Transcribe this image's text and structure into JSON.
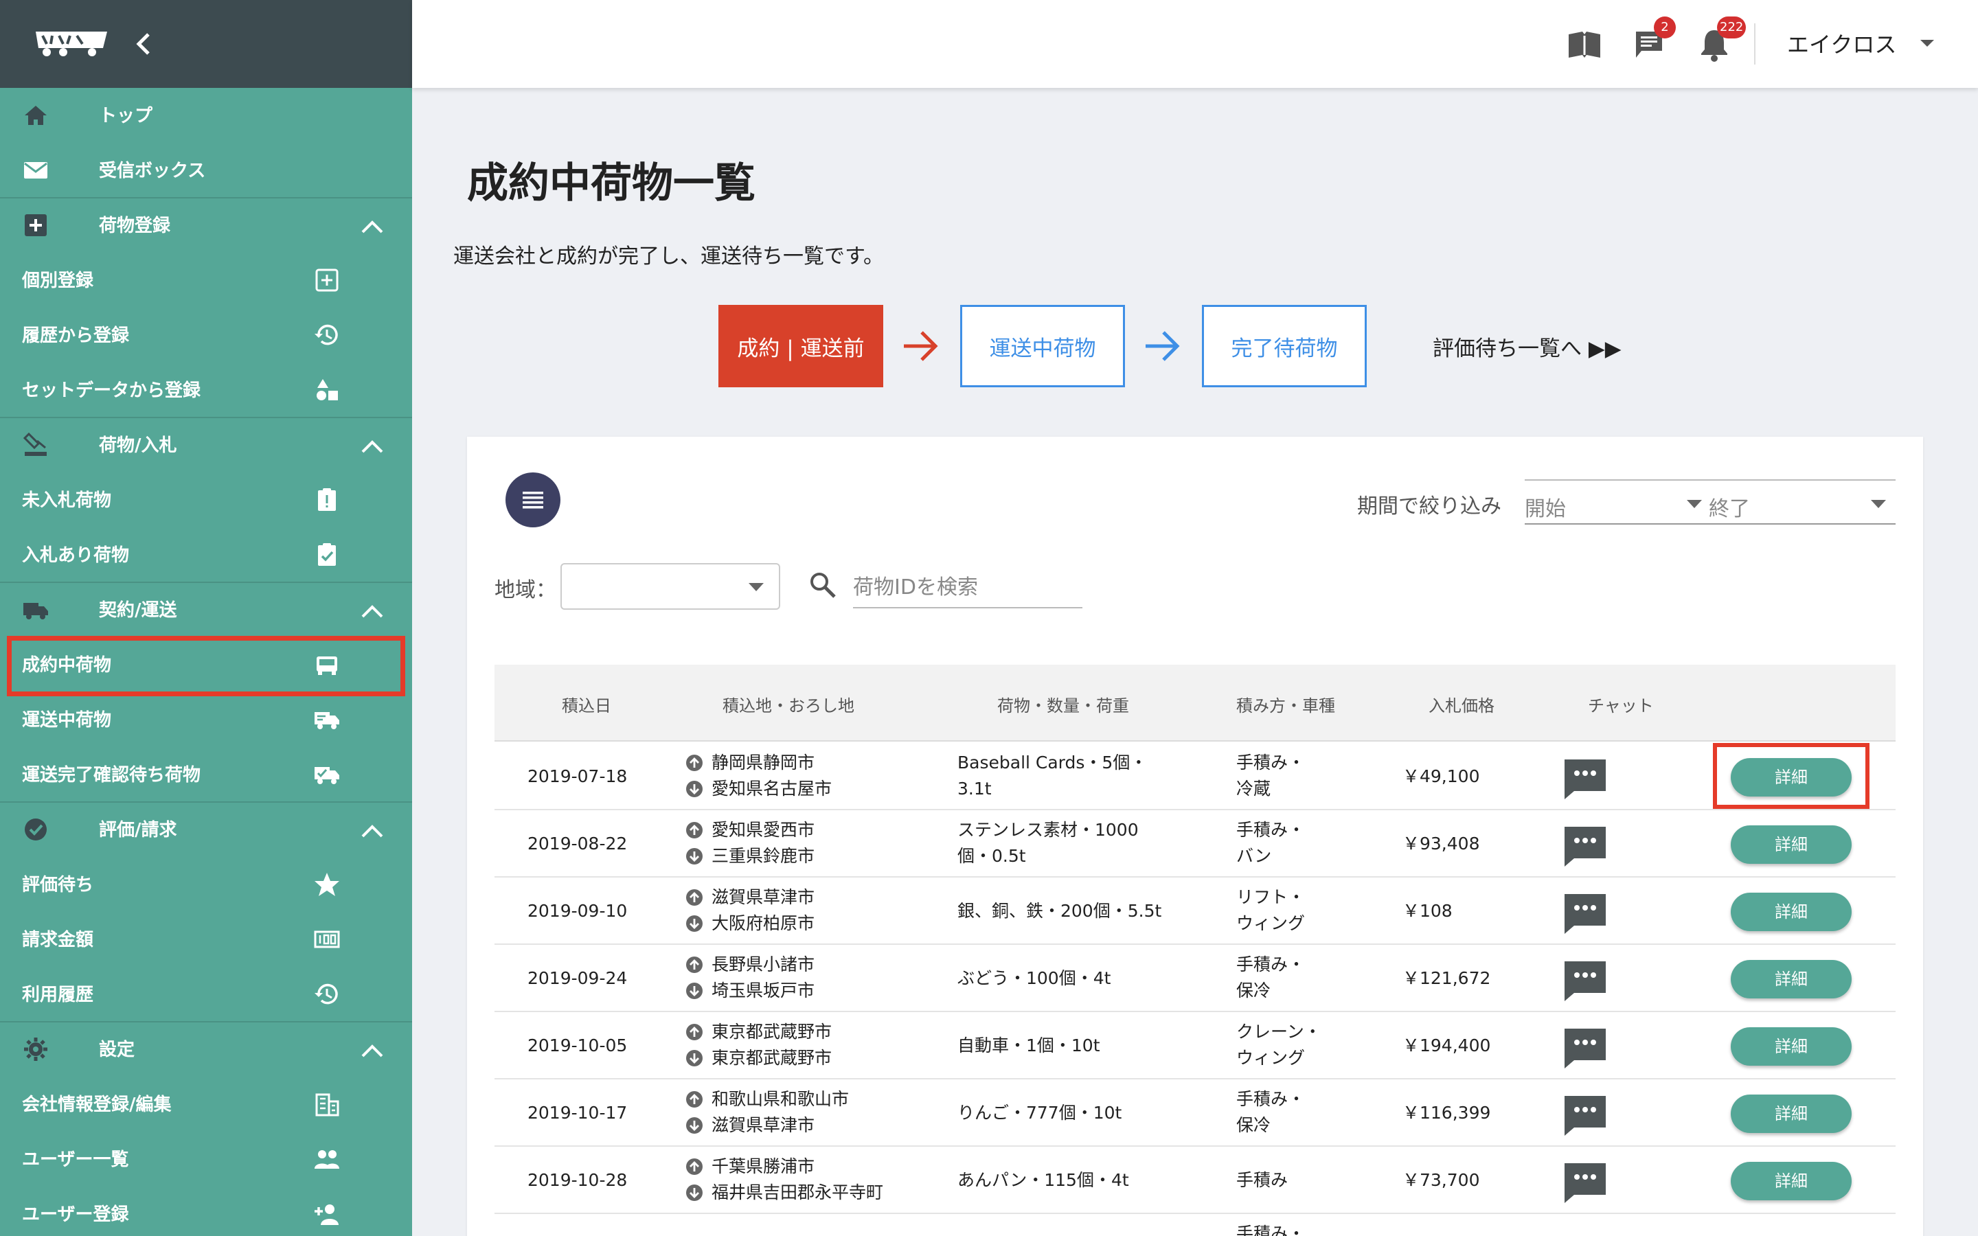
{
  "sidebar": {
    "items": [
      {
        "label": "トップ",
        "icon": "home-icon"
      },
      {
        "label": "受信ボックス",
        "icon": "mail-icon"
      },
      {
        "label": "荷物登録",
        "icon": "add-box-icon",
        "section": true
      },
      {
        "label": "個別登録",
        "icon": "add-square-icon"
      },
      {
        "label": "履歴から登録",
        "icon": "history-icon"
      },
      {
        "label": "セットデータから登録",
        "icon": "shapes-icon"
      },
      {
        "label": "荷物/入札",
        "icon": "bid-icon",
        "section": true
      },
      {
        "label": "未入札荷物",
        "icon": "clipboard-alert-icon"
      },
      {
        "label": "入札あり荷物",
        "icon": "clipboard-check-icon"
      },
      {
        "label": "契約/運送",
        "icon": "truck-icon",
        "section": true
      },
      {
        "label": "成約中荷物",
        "icon": "truck-front-icon",
        "active": true
      },
      {
        "label": "運送中荷物",
        "icon": "truck-moving-icon"
      },
      {
        "label": "運送完了確認待ち荷物",
        "icon": "truck-check-icon"
      },
      {
        "label": "評価/請求",
        "icon": "check-circle-icon",
        "section": true
      },
      {
        "label": "評価待ち",
        "icon": "star-icon"
      },
      {
        "label": "請求金額",
        "icon": "counter-icon"
      },
      {
        "label": "利用履歴",
        "icon": "history-icon"
      },
      {
        "label": "設定",
        "icon": "gear-icon",
        "section": true
      },
      {
        "label": "会社情報登録/編集",
        "icon": "building-icon"
      },
      {
        "label": "ユーザー一覧",
        "icon": "users-icon"
      },
      {
        "label": "ユーザー登録",
        "icon": "user-add-icon"
      }
    ]
  },
  "header": {
    "chat_badge": "2",
    "notification_badge": "222",
    "user_name": "エイクロス"
  },
  "main": {
    "title": "成約中荷物一覧",
    "description": "運送会社と成約が完了し、運送待ち一覧です。",
    "steps": [
      "成約 | 運送前",
      "運送中荷物",
      "完了待荷物"
    ],
    "review_link": "評価待ち一覧へ ▶▶",
    "period_label": "期間で絞り込み",
    "period_start_placeholder": "開始",
    "period_end_placeholder": "終了",
    "region_label": "地域：",
    "search_placeholder": "荷物IDを検索"
  },
  "table": {
    "columns": [
      "積込日",
      "積込地・おろし地",
      "荷物・数量・荷重",
      "積み方・車種",
      "入札価格",
      "チャット"
    ],
    "detail_label": "詳細",
    "rows": [
      {
        "date": "2019-07-18",
        "from": "静岡県静岡市",
        "to": "愛知県名古屋市",
        "cargo1": "Baseball Cards・5個・",
        "cargo2": "3.1t",
        "load1": "手積み・",
        "load2": "冷蔵",
        "price": "￥49,100"
      },
      {
        "date": "2019-08-22",
        "from": "愛知県愛西市",
        "to": "三重県鈴鹿市",
        "cargo1": "ステンレス素材・1000",
        "cargo2": "個・0.5t",
        "load1": "手積み・",
        "load2": "バン",
        "price": "￥93,408"
      },
      {
        "date": "2019-09-10",
        "from": "滋賀県草津市",
        "to": "大阪府柏原市",
        "cargo1": "銀、銅、鉄・200個・5.5t",
        "cargo2": "",
        "load1": "リフト・",
        "load2": "ウィング",
        "price": "￥108"
      },
      {
        "date": "2019-09-24",
        "from": "長野県小諸市",
        "to": "埼玉県坂戸市",
        "cargo1": "ぶどう・100個・4t",
        "cargo2": "",
        "load1": "手積み・",
        "load2": "保冷",
        "price": "￥121,672"
      },
      {
        "date": "2019-10-05",
        "from": "東京都武蔵野市",
        "to": "東京都武蔵野市",
        "cargo1": "自動車・1個・10t",
        "cargo2": "",
        "load1": "クレーン・",
        "load2": "ウィング",
        "price": "￥194,400"
      },
      {
        "date": "2019-10-17",
        "from": "和歌山県和歌山市",
        "to": "滋賀県草津市",
        "cargo1": "りんご・777個・10t",
        "cargo2": "",
        "load1": "手積み・",
        "load2": "保冷",
        "price": "￥116,399"
      },
      {
        "date": "2019-10-28",
        "from": "千葉県勝浦市",
        "to": "福井県吉田郡永平寺町",
        "cargo1": "あんパン・115個・4t",
        "cargo2": "",
        "load1": "手積み",
        "load2": "",
        "price": "￥73,700"
      },
      {
        "date": "",
        "from": "",
        "to": "",
        "cargo1": "",
        "cargo2": "",
        "load1": "手積み・",
        "load2": "",
        "price": ""
      }
    ]
  },
  "colors": {
    "sidebar": "#55a797",
    "brand_bar": "#3d4b50",
    "step_active": "#d8412a",
    "step_outline": "#3e8fe6",
    "highlight": "#e53b29"
  }
}
